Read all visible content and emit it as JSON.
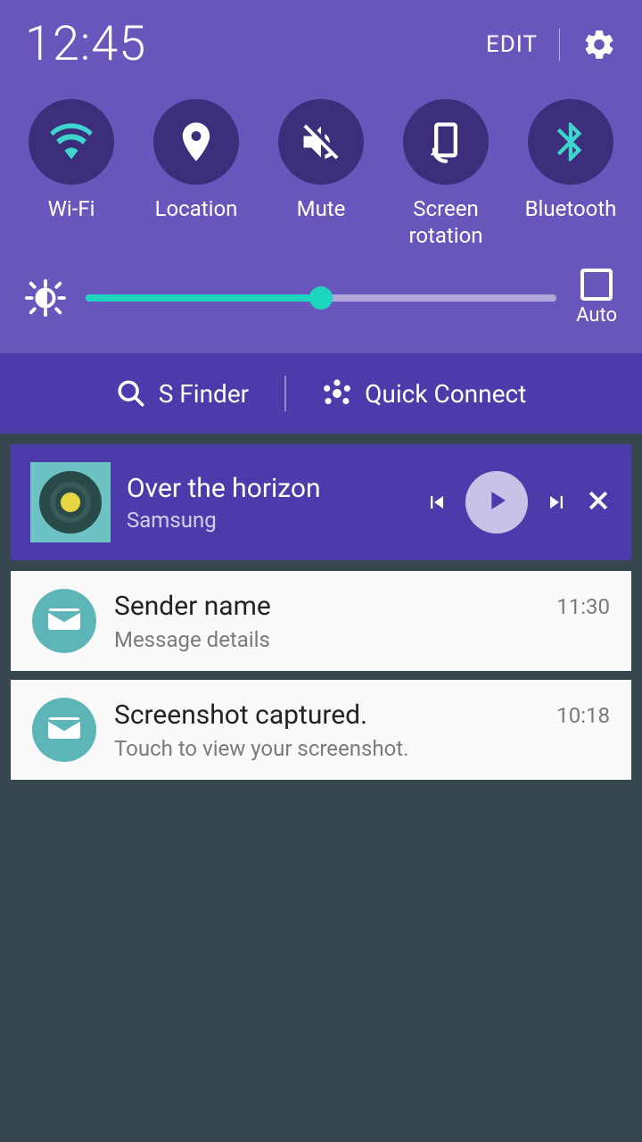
{
  "header": {
    "time": "12:45",
    "edit_label": "EDIT"
  },
  "toggles": [
    {
      "label": "Wi-Fi",
      "active_color": "#3fd5cf"
    },
    {
      "label": "Location",
      "active_color": "#ffffff"
    },
    {
      "label": "Mute",
      "active_color": "#ffffff"
    },
    {
      "label": "Screen rotation",
      "active_color": "#ffffff"
    },
    {
      "label": "Bluetooth",
      "active_color": "#3fd5cf"
    }
  ],
  "brightness": {
    "auto_label": "Auto",
    "percent": 50
  },
  "bar": {
    "sfinder_label": "S Finder",
    "quickconnect_label": "Quick Connect"
  },
  "media": {
    "title": "Over the horizon",
    "artist": "Samsung"
  },
  "notifications": [
    {
      "title": "Sender name",
      "detail": "Message details",
      "time": "11:30"
    },
    {
      "title": "Screenshot captured.",
      "detail": "Touch to view your screenshot.",
      "time": "10:18"
    }
  ]
}
